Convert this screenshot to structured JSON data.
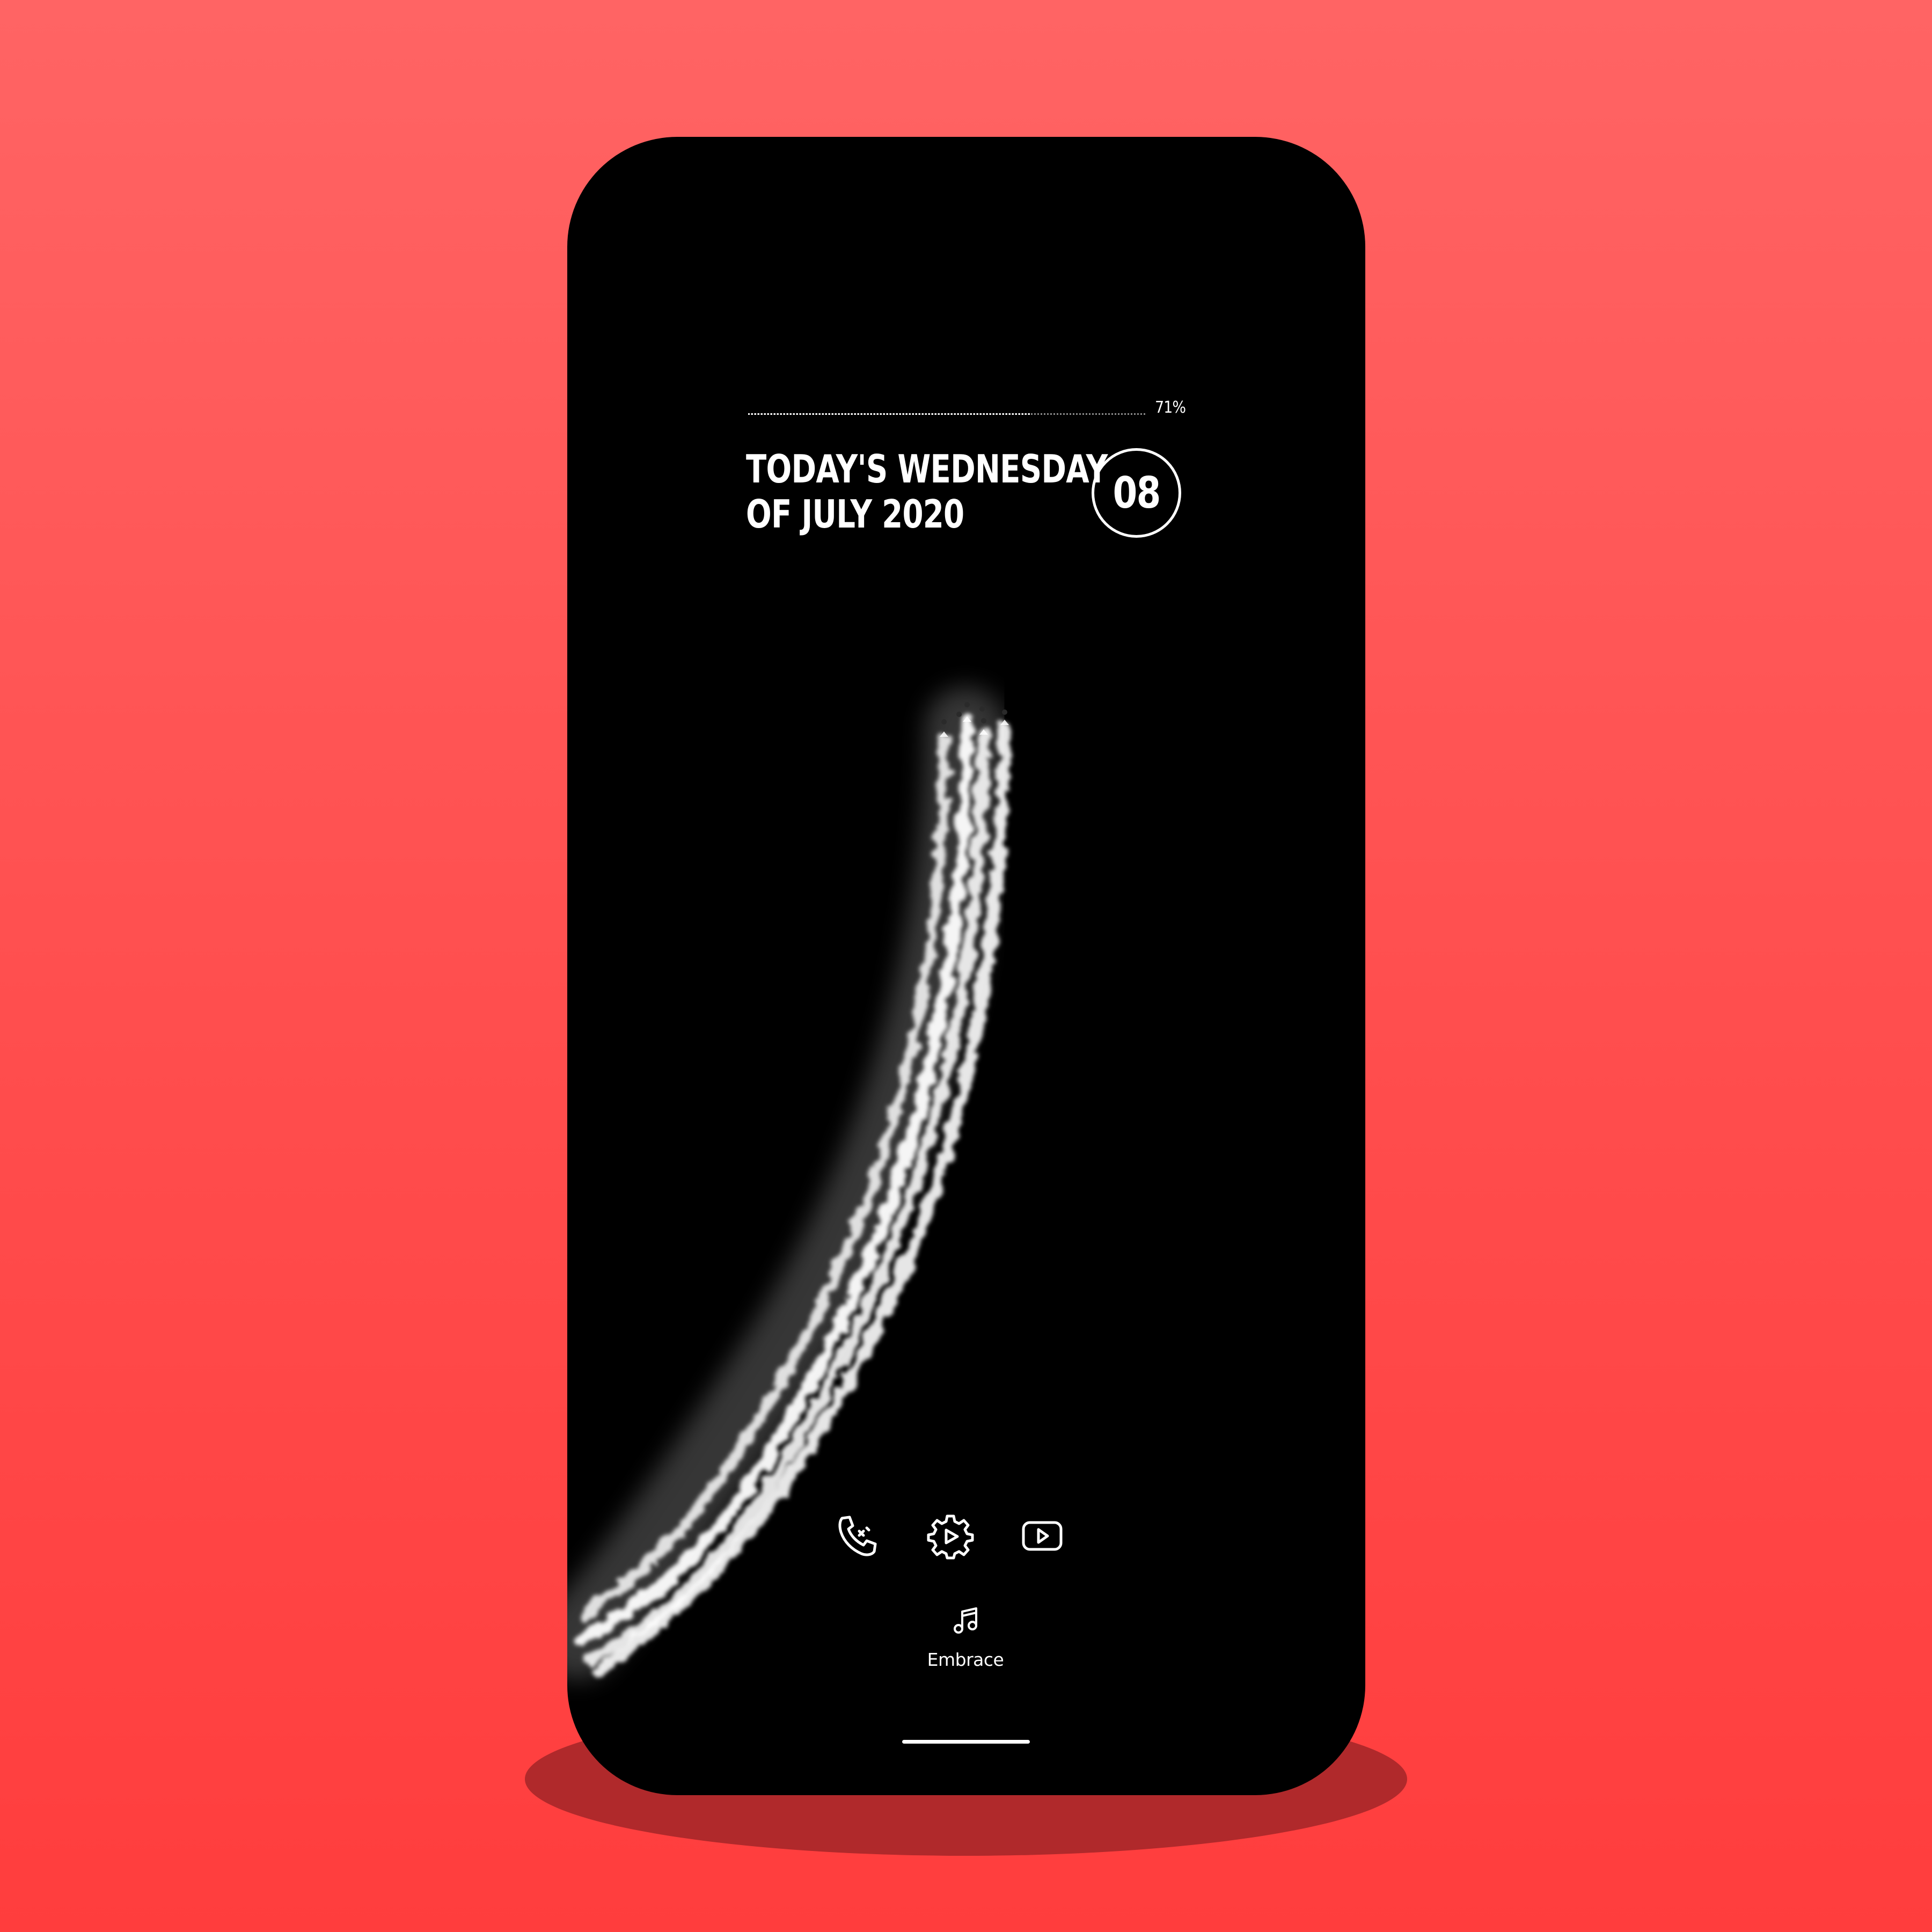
{
  "colors": {
    "background_top": "#ff6464",
    "background_bottom": "#ff3d3d",
    "shadow": "#b0292b",
    "phone_body": "#000000",
    "foreground": "#ffffff"
  },
  "lockscreen": {
    "battery": {
      "percent_label": "71%",
      "level": 0.71
    },
    "date": {
      "line1": "TODAY'S WEDNESDAY",
      "line2": "OF JULY 2020",
      "day": "08"
    },
    "wallpaper": {
      "subject": "aircraft-smoke-trails"
    },
    "dock": {
      "icons": [
        "phone-icon",
        "settings-icon",
        "youtube-icon"
      ]
    },
    "music": {
      "icon": "music-note-icon",
      "track_title": "Embrace"
    }
  }
}
